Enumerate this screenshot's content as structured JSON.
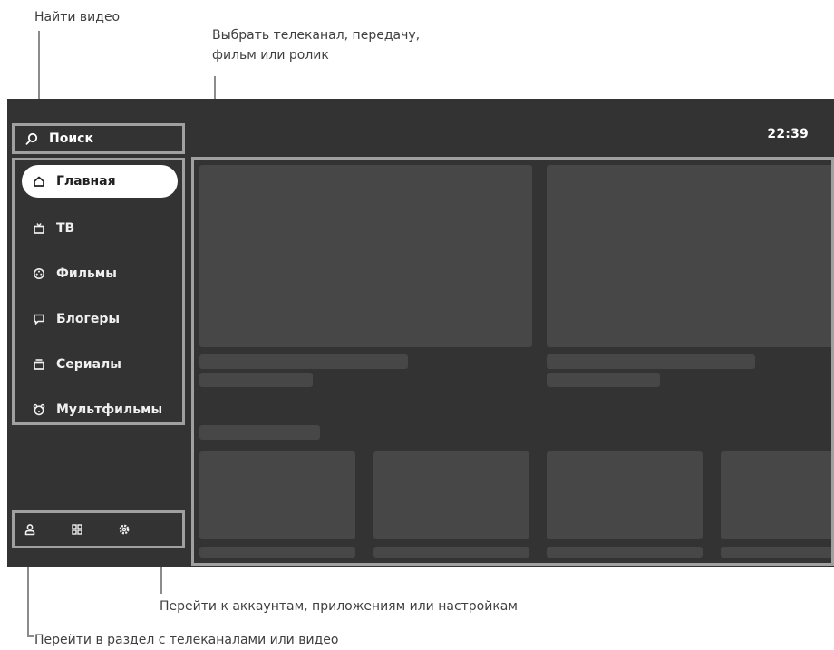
{
  "annotations": {
    "search_label": "Найти видео",
    "content_label_line1": "Выбрать телеканал, передачу,",
    "content_label_line2": "фильм или ролик",
    "utility_label": "Перейти к аккаунтам, приложениям или настройкам",
    "nav_label": "Перейти в раздел с телеканалами или видео"
  },
  "status": {
    "time": "22:39"
  },
  "search": {
    "label": "Поиск",
    "icon": "search-icon"
  },
  "nav": {
    "items": [
      {
        "label": "Главная",
        "icon": "home-icon",
        "active": true
      },
      {
        "label": "ТВ",
        "icon": "tv-icon",
        "active": false
      },
      {
        "label": "Фильмы",
        "icon": "film-reel-icon",
        "active": false
      },
      {
        "label": "Блогеры",
        "icon": "chat-bubble-icon",
        "active": false
      },
      {
        "label": "Сериалы",
        "icon": "series-stack-icon",
        "active": false
      },
      {
        "label": "Мультфильмы",
        "icon": "cartoon-bear-icon",
        "active": false
      }
    ]
  },
  "utility": {
    "items": [
      {
        "icon": "user-icon"
      },
      {
        "icon": "apps-grid-icon"
      },
      {
        "icon": "gear-icon"
      }
    ]
  },
  "colors": {
    "screen_bg": "#333333",
    "placeholder": "#474747",
    "outline": "#a0a0a0",
    "active_item_bg": "#ffffff",
    "annotation_text": "#3f3f3f"
  }
}
